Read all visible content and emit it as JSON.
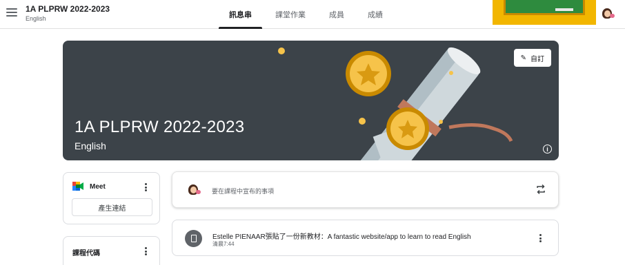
{
  "header": {
    "title": "1A PLPRW 2022-2023",
    "subtitle": "English",
    "menu_icon": "hamburger-menu-icon",
    "tabs": [
      {
        "label": "訊息串",
        "active": true
      },
      {
        "label": "課堂作業",
        "active": false
      },
      {
        "label": "成員",
        "active": false
      },
      {
        "label": "成績",
        "active": false
      }
    ]
  },
  "banner": {
    "title": "1A PLPRW 2022-2023",
    "subtitle": "English",
    "customize_label": "自訂",
    "customize_icon": "pencil-icon",
    "info_icon": "info-icon",
    "background_color": "#3c4349"
  },
  "meet": {
    "label": "Meet",
    "button_label": "產生連結"
  },
  "class_code": {
    "label": "課程代碼"
  },
  "announce": {
    "placeholder": "要在課程中宣布的事項",
    "repost_icon": "repost-icon"
  },
  "post": {
    "title": "Estelle PIENAAR張貼了一份新教材：A fantastic website/app to learn to read English",
    "time": "清晨7:44",
    "icon": "material-book-icon"
  },
  "colors": {
    "accent": "#202124",
    "banner": "#3c4349",
    "thumbnail_bg": "#f2b600",
    "chalkboard": "#2e8b3e"
  }
}
